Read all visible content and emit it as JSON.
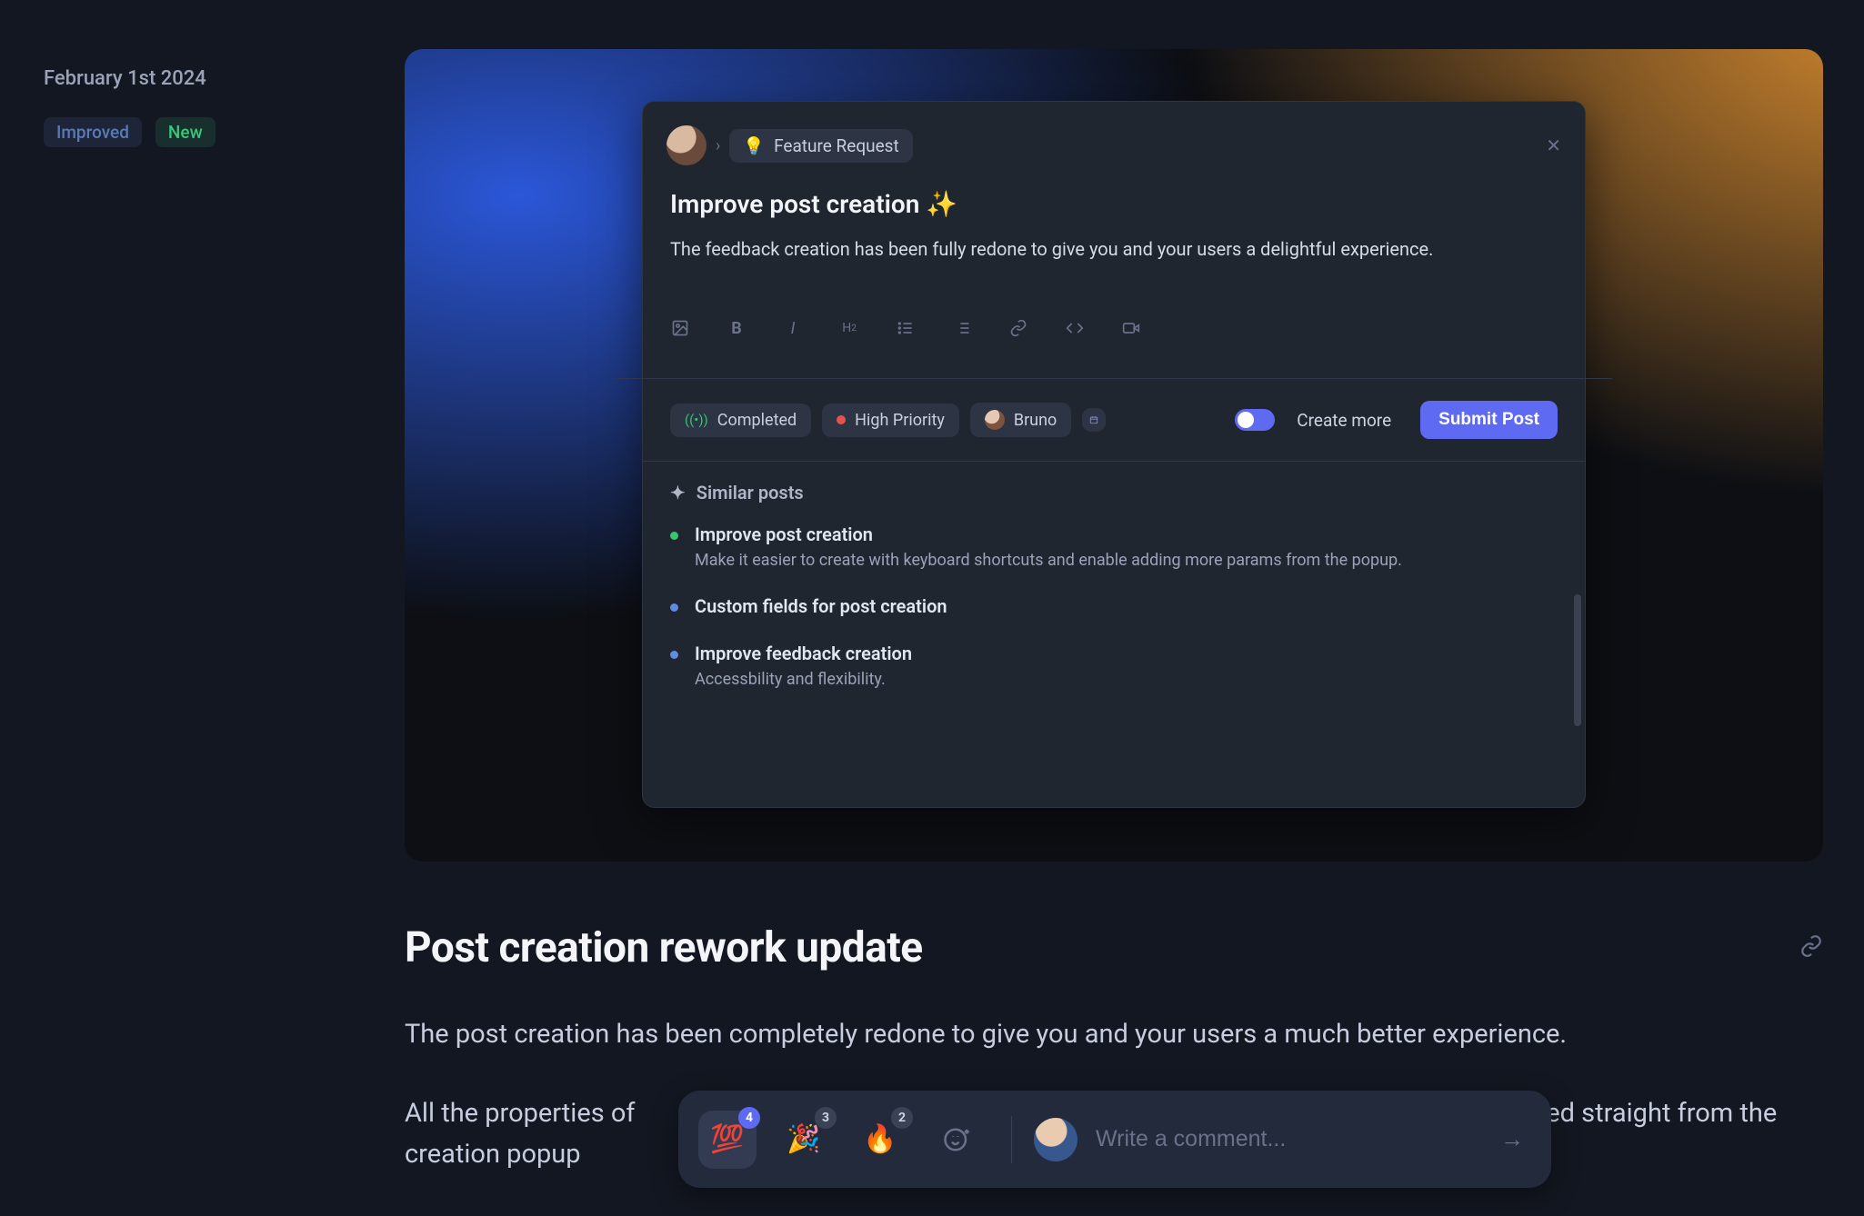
{
  "meta": {
    "date": "February 1st 2024",
    "tags": {
      "improved": "Improved",
      "new": "New"
    }
  },
  "hero": {
    "breadcrumb": "Feature Request",
    "title": "Improve post creation ✨",
    "description": "The feedback creation has been fully redone to give you and your users a delightful experience.",
    "toolbar_icons": [
      "image",
      "bold",
      "italic",
      "h2",
      "ul",
      "ol",
      "link",
      "code",
      "video"
    ],
    "props": {
      "status": "Completed",
      "priority": "High Priority",
      "assignee": "Bruno",
      "create_more": "Create more",
      "submit": "Submit Post"
    },
    "similar": {
      "heading": "Similar posts",
      "items": [
        {
          "color": "g",
          "title": "Improve post creation",
          "desc": "Make it easier to create with keyboard shortcuts and enable adding more params from the popup."
        },
        {
          "color": "b",
          "title": "Custom fields for post creation",
          "desc": ""
        },
        {
          "color": "b",
          "title": "Improve feedback creation",
          "desc": "Accessbility and flexibility."
        }
      ]
    }
  },
  "article": {
    "heading": "Post creation rework update",
    "p1": "The post creation has been completely redone to give you and your users a much better experience.",
    "p2": "All the properties of<span style=\"opacity:0\">xxxxxxxxxxxxxxxxxxxxxxxxxxxxxxxxxxxxxxxxxxxxxxxxxxxxxxxxxxxxxxxxxxxx</span>lded straight from the creation popup"
  },
  "floatbar": {
    "reactions": [
      {
        "emoji": "💯",
        "count": "4",
        "active": true
      },
      {
        "emoji": "🎉",
        "count": "3",
        "active": false
      },
      {
        "emoji": "🔥",
        "count": "2",
        "active": false
      }
    ],
    "placeholder": "Write a comment..."
  }
}
